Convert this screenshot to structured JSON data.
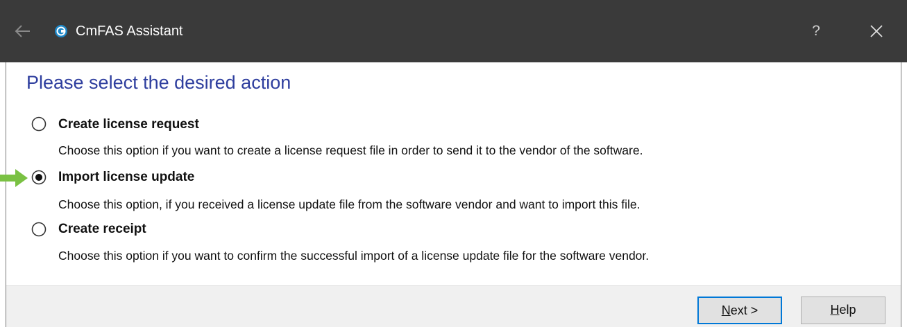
{
  "window": {
    "title": "CmFAS Assistant",
    "help_label": "?"
  },
  "main": {
    "heading": "Please select the desired action",
    "options": [
      {
        "label": "Create license request",
        "description": "Choose this option if you want to create a license request file in order to send it to the vendor of the software.",
        "selected": false
      },
      {
        "label": "Import license update",
        "description": "Choose this option, if you received a license update file from the software vendor and want to import this file.",
        "selected": true
      },
      {
        "label": "Create receipt",
        "description": "Choose this option if you want to confirm the successful import of a license update file for the software vendor.",
        "selected": false
      }
    ]
  },
  "footer": {
    "next_accel": "N",
    "next_rest": "ext >",
    "help_accel": "H",
    "help_rest": "elp"
  },
  "colors": {
    "titlebar": "#3a3a3a",
    "heading": "#2e3e9e",
    "arrow": "#7ac143",
    "focus": "#0078d7"
  },
  "icons": {
    "back": "back-arrow-icon",
    "app": "codemeter-app-icon",
    "close": "close-icon",
    "pointer": "green-pointer-arrow-icon"
  }
}
